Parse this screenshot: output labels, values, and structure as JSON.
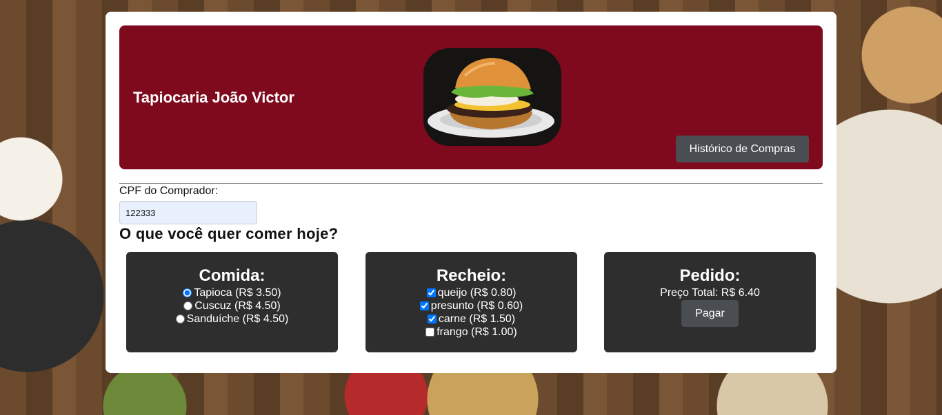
{
  "header": {
    "brand": "Tapiocaria João Victor",
    "history_button": "Histórico de Compras"
  },
  "form": {
    "cpf_label": "CPF do Comprador:",
    "cpf_value": "122333",
    "question": "O que você quer comer hoje?"
  },
  "comida": {
    "title": "Comida:",
    "options": [
      {
        "label": "Tapioca (R$ 3.50)",
        "selected": true
      },
      {
        "label": "Cuscuz (R$ 4.50)",
        "selected": false
      },
      {
        "label": "Sanduíche (R$ 4.50)",
        "selected": false
      }
    ]
  },
  "recheio": {
    "title": "Recheio:",
    "options": [
      {
        "label": "queijo (R$ 0.80)",
        "checked": true
      },
      {
        "label": "presunto (R$ 0.60)",
        "checked": true
      },
      {
        "label": "carne (R$ 1.50)",
        "checked": true
      },
      {
        "label": "frango (R$ 1.00)",
        "checked": false
      }
    ]
  },
  "pedido": {
    "title": "Pedido:",
    "total": "Preço Total: R$ 6.40",
    "pay_button": "Pagar"
  },
  "colors": {
    "header_bg": "#7f0a1e",
    "panel_bg": "#2e2e2e",
    "button_bg": "#4a4d52"
  },
  "icons": {
    "header_image": "burger-image"
  }
}
